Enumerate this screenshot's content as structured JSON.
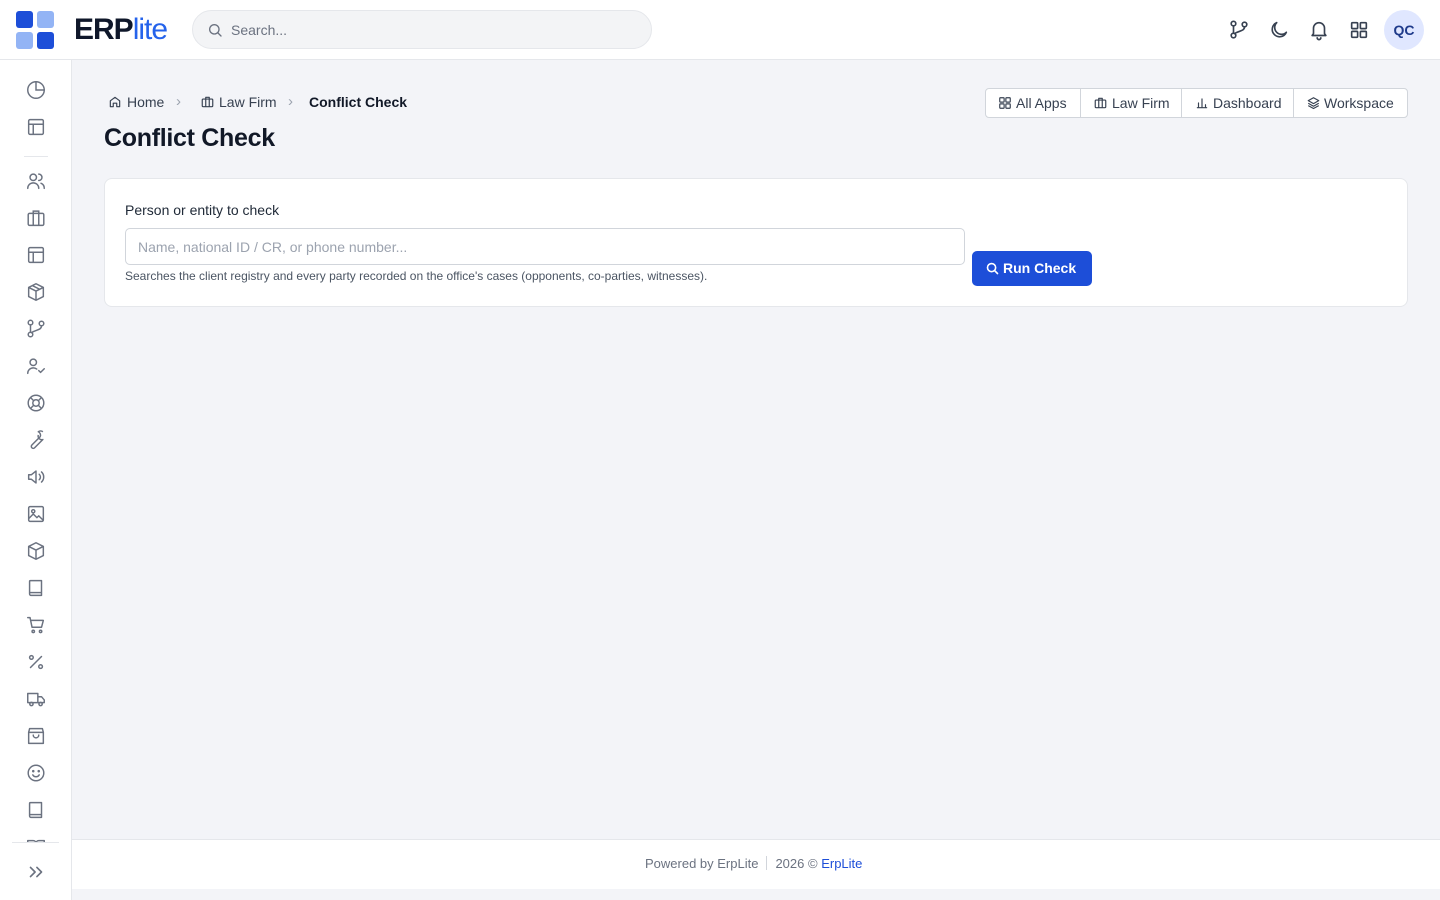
{
  "brand": {
    "name_main": "ERP",
    "name_accent": "lite",
    "colors": {
      "logo_dark": "#1d4ed8",
      "logo_light": "#93b4f5",
      "primary": "#1d4ed8"
    }
  },
  "search": {
    "placeholder": "Search..."
  },
  "topbar_icons": [
    "branch-icon",
    "moon-icon",
    "bell-icon",
    "apps-grid-icon"
  ],
  "user": {
    "initials": "QC"
  },
  "sidebar": {
    "items": [
      "chart-pie-icon",
      "layout-icon",
      "users-icon",
      "briefcase-icon",
      "layout-icon",
      "package-icon",
      "branch-icon",
      "user-check-icon",
      "lifebuoy-icon",
      "wrench-icon",
      "megaphone-icon",
      "image-icon",
      "box-icon",
      "book-icon",
      "cart-icon",
      "percent-icon",
      "truck-icon",
      "shopping-bag-icon",
      "smile-icon",
      "book-icon"
    ],
    "expand_icon": "chevrons-right-icon"
  },
  "breadcrumb": {
    "home": "Home",
    "law_firm": "Law Firm",
    "current": "Conflict Check"
  },
  "page": {
    "title": "Conflict Check"
  },
  "quick_nav": {
    "all_apps": "All Apps",
    "law_firm": "Law Firm",
    "dashboard": "Dashboard",
    "workspace": "Workspace"
  },
  "form": {
    "label": "Person or entity to check",
    "value": "",
    "placeholder": "Name, national ID / CR, or phone number...",
    "help": "Searches the client registry and every party recorded on the office's cases (opponents, co-parties, witnesses).",
    "submit": "Run Check"
  },
  "footer": {
    "powered_by": "Powered by ErpLite",
    "copyright": "2026 ©",
    "link": "ErpLite"
  }
}
